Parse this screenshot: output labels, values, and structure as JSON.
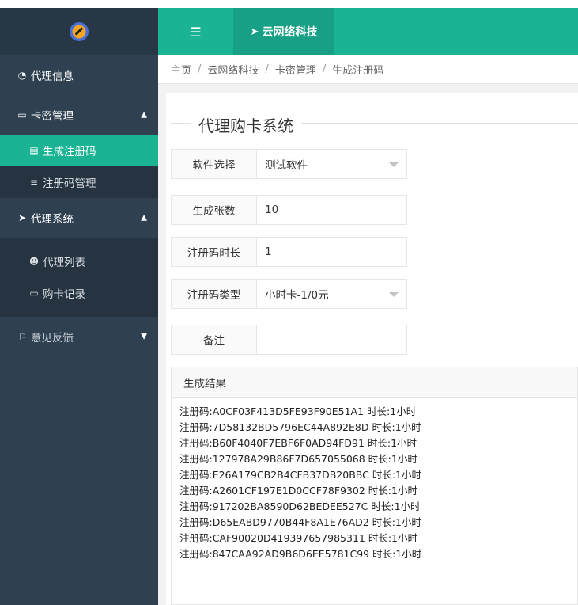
{
  "colors": {
    "sidebar": "#2f4050",
    "accent": "#1ab394"
  },
  "header": {
    "toggle_icon": "menu-indent-icon",
    "brand_icon": "paper-plane-icon",
    "brand_label": "云网络科技"
  },
  "sidebar": {
    "logo_icon": "logo-icon",
    "items": [
      {
        "icon": "dashboard-icon",
        "label": "代理信息"
      },
      {
        "icon": "window-icon",
        "label": "卡密管理",
        "arrow": "caret-up-icon"
      },
      {
        "icon": "card-list-icon",
        "label": "生成注册码",
        "active": true
      },
      {
        "icon": "bars-icon",
        "label": "注册码管理"
      },
      {
        "icon": "send-icon",
        "label": "代理系统",
        "arrow": "caret-up-icon"
      },
      {
        "icon": "users-icon",
        "label": "代理列表"
      },
      {
        "icon": "credit-card-icon",
        "label": "购卡记录"
      },
      {
        "icon": "flag-icon",
        "label": "意见反馈",
        "arrow": "caret-down-icon"
      }
    ]
  },
  "breadcrumb": [
    "主页",
    "云网络科技",
    "卡密管理",
    "生成注册码"
  ],
  "panel": {
    "title": "代理购卡系统",
    "fields": {
      "software": {
        "label": "软件选择",
        "value": "测试软件"
      },
      "count": {
        "label": "生成张数",
        "value": "10"
      },
      "duration": {
        "label": "注册码时长",
        "value": "1"
      },
      "type": {
        "label": "注册码类型",
        "value": "小时卡-1/0元"
      },
      "remark": {
        "label": "备注",
        "value": ""
      }
    },
    "result": {
      "title": "生成结果",
      "lines": [
        "注册码:A0CF03F413D5FE93F90E51A1  时长:1小时",
        "注册码:7D58132BD5796EC44A892E8D  时长:1小时",
        "注册码:B60F4040F7EBF6F0AD94FD91  时长:1小时",
        "注册码:127978A29B86F7D657055068  时长:1小时",
        "注册码:E26A179CB2B4CFB37DB20BBC  时长:1小时",
        "注册码:A2601CF197E1D0CCF78F9302  时长:1小时",
        "注册码:917202BA8590D62BEDEE527C  时长:1小时",
        "注册码:D65EABD9770B44F8A1E76AD2  时长:1小时",
        "注册码:CAF90020D419397657985311  时长:1小时",
        "注册码:847CAA92AD9B6D6EE5781C99  时长:1小时"
      ]
    }
  }
}
